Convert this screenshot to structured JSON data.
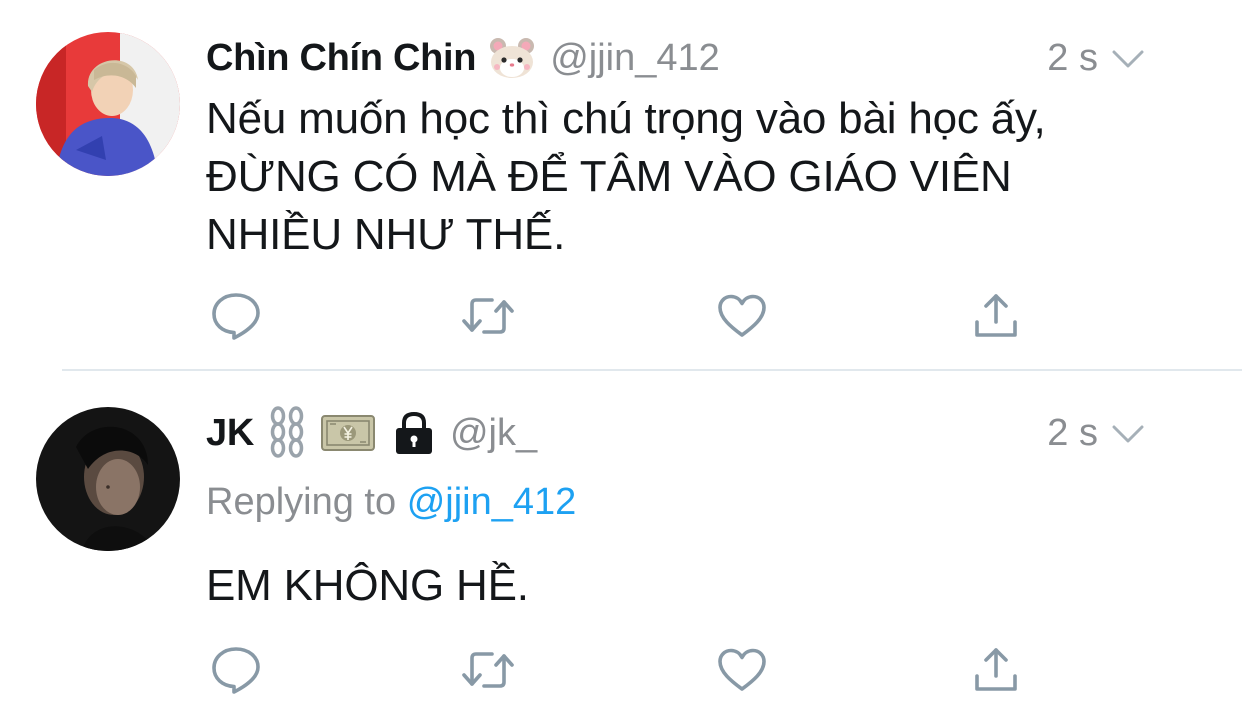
{
  "colors": {
    "text": "#14171a",
    "secondary": "#8a8d91",
    "link": "#1da1f2",
    "icon": "#8899a6",
    "divider": "#e1e8ed"
  },
  "tweets": [
    {
      "display_name": "Chìn Chín Chin",
      "name_emoji": "hamster-face-emoji",
      "handle": "@jjin_412",
      "time": "2 s",
      "text_lines": [
        "Nếu muốn học thì chú trọng vào bài học ấy,",
        "ĐỪNG CÓ MÀ ĐỂ TÂM VÀO GIÁO VIÊN",
        "NHIỀU NHƯ THẾ."
      ],
      "icons": [
        "reply-icon",
        "retweet-icon",
        "like-icon",
        "share-icon"
      ]
    },
    {
      "display_name": "JK",
      "name_emoji": "chains-emoji, yen-banknote-emoji",
      "protected_icon": "lock-icon",
      "handle": "@jk_",
      "time": "2 s",
      "reply_prefix": "Replying to",
      "reply_mention": "@jjin_412",
      "text_lines": [
        "EM KHÔNG HỀ."
      ],
      "icons": [
        "reply-icon",
        "retweet-icon",
        "like-icon",
        "share-icon"
      ]
    }
  ]
}
